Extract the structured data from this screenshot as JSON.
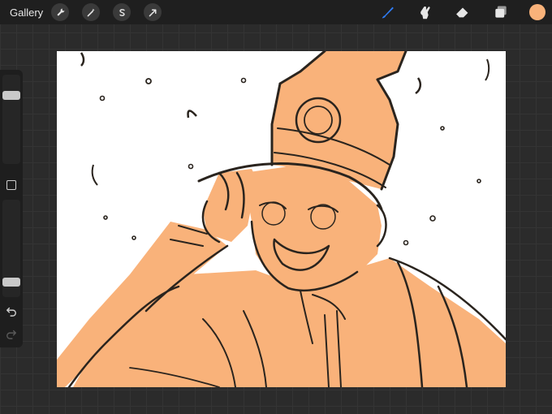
{
  "topbar": {
    "gallery_label": "Gallery",
    "left_tools": [
      "wrench-icon",
      "magic-wand-icon",
      "selection-s-icon",
      "transform-arrow-icon"
    ],
    "right_tools": [
      "brush-icon",
      "smudge-icon",
      "eraser-icon",
      "layers-icon"
    ],
    "active_tool": "brush-icon",
    "active_tool_color": "#2f7df6",
    "current_color": "#f9b27a"
  },
  "sidebar": {
    "brush_size_level": 0.2,
    "opacity_level": 0.88
  },
  "canvas": {
    "background": "#ffffff",
    "fill_color": "#f9b27a",
    "line_color": "#2a241e"
  }
}
